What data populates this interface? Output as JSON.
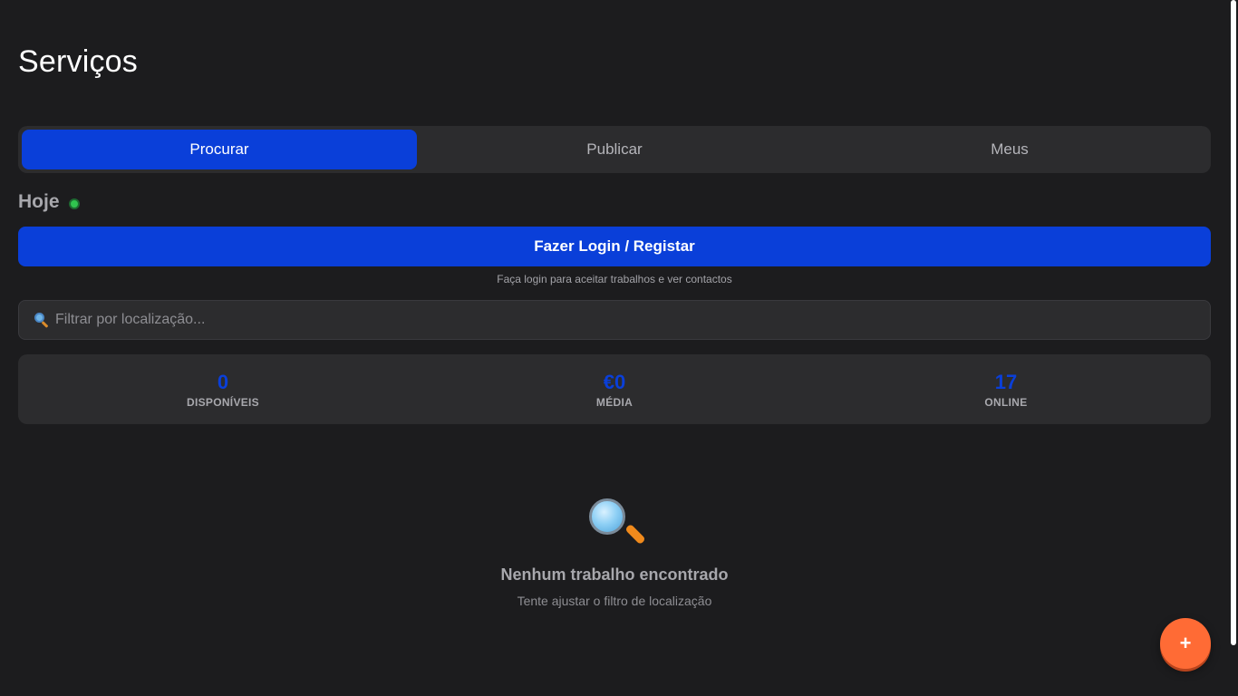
{
  "header": {
    "title": "Serviços"
  },
  "tabs": [
    {
      "label": "Procurar",
      "active": true
    },
    {
      "label": "Publicar",
      "active": false
    },
    {
      "label": "Meus",
      "active": false
    }
  ],
  "section": {
    "title": "Hoje",
    "status_color": "#30c44f"
  },
  "login": {
    "button_label": "Fazer Login / Registar",
    "hint": "Faça login para aceitar trabalhos e ver contactos"
  },
  "filter": {
    "icon": "search-icon",
    "placeholder": "Filtrar por localização...",
    "value": ""
  },
  "stats": [
    {
      "value": "0",
      "label": "DISPONÍVEIS"
    },
    {
      "value": "€0",
      "label": "MÉDIA"
    },
    {
      "value": "17",
      "label": "ONLINE"
    }
  ],
  "empty_state": {
    "icon": "magnifying-glass-icon",
    "title": "Nenhum trabalho encontrado",
    "subtitle": "Tente ajustar o filtro de localização"
  },
  "fab": {
    "label": "+",
    "color": "#ff6b35"
  },
  "colors": {
    "accent": "#0a3fd9",
    "background": "#1c1c1e",
    "surface": "#2c2c2e"
  }
}
